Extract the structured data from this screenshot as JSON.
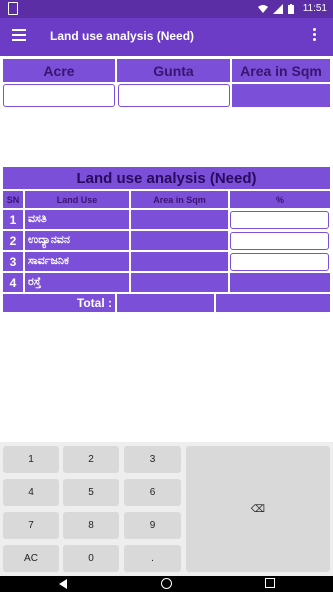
{
  "status": {
    "time": "11:51"
  },
  "appbar": {
    "title": "Land use analysis (Need)"
  },
  "conversion": {
    "headers": [
      "Acre",
      "Gunta",
      "Area in Sqm"
    ]
  },
  "table": {
    "title": "Land use analysis (Need)",
    "headers": [
      "SN",
      "Land Use",
      "Area in Sqm",
      "%"
    ],
    "rows": [
      {
        "sn": "1",
        "land_use": "ವಸತಿ"
      },
      {
        "sn": "2",
        "land_use": "ಉದ್ಯಾನವನ"
      },
      {
        "sn": "3",
        "land_use": "ಸಾರ್ವಜನಿಕ"
      },
      {
        "sn": "4",
        "land_use": "ರಸ್ತೆ"
      }
    ],
    "total_label": "Total :"
  },
  "keypad": {
    "keys": [
      "1",
      "2",
      "3",
      "4",
      "5",
      "6",
      "7",
      "8",
      "9",
      "AC",
      "0",
      "."
    ],
    "backspace": "⌫"
  }
}
